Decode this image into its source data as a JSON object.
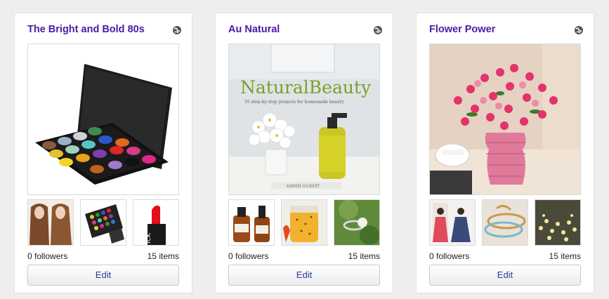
{
  "boards": [
    {
      "title": "The Bright and Bold 80s",
      "followers": "0 followers",
      "items": "15 items",
      "edit_label": "Edit"
    },
    {
      "title": "Au Natural",
      "followers": "0 followers",
      "items": "15 items",
      "edit_label": "Edit",
      "cover_text": {
        "title": "NaturalBeauty",
        "subtitle": "35 step-by-step projects for homemade beauty",
        "author": "KAREN GILBERT"
      }
    },
    {
      "title": "Flower Power",
      "followers": "0 followers",
      "items": "15 items",
      "edit_label": "Edit"
    }
  ],
  "colors": {
    "title": "#4a1aa8",
    "button_text": "#2a3aa0"
  },
  "icons": {
    "share": "share-globe-icon"
  }
}
